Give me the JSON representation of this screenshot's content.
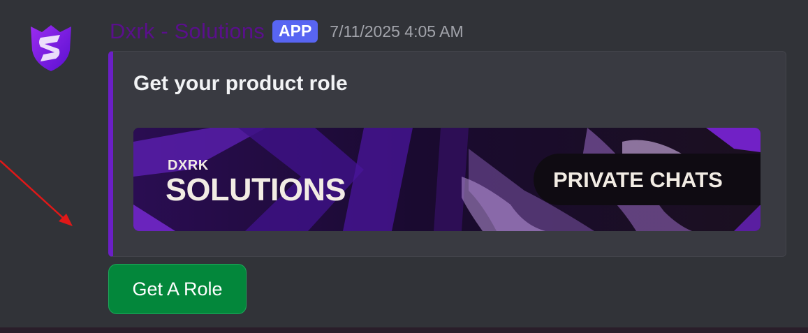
{
  "message": {
    "username": "Dxrk - Solutions",
    "badge": "APP",
    "timestamp": "7/11/2025 4:05 AM",
    "avatar_icon": "shield-s-logo-icon"
  },
  "embed": {
    "title": "Get your product role",
    "accent_color": "#6b1fc6",
    "banner": {
      "small_text": "DXRK",
      "big_text": "SOLUTIONS",
      "pill_text": "PRIVATE CHATS"
    }
  },
  "actions": {
    "button_label": "Get A Role",
    "button_color": "#03873b"
  },
  "annotation": {
    "arrow_color": "#e01818"
  },
  "colors": {
    "background": "#313338",
    "badge": "#5865f2",
    "username": "#5a0f8c"
  }
}
